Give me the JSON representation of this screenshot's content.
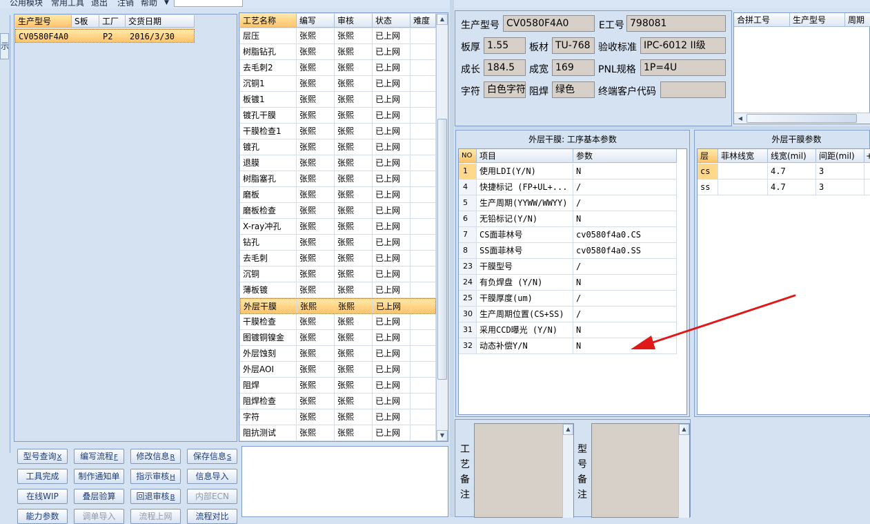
{
  "menubar": {
    "items": [
      "公用模块",
      "常用工具",
      "退出",
      "注销",
      "帮助"
    ]
  },
  "left_stub": {
    "button_label": "示"
  },
  "model_list": {
    "columns": [
      "生产型号",
      "S板",
      "工厂",
      "交货日期"
    ],
    "rows": [
      {
        "model": "CV0580F4A0",
        "s_board": "",
        "factory": "P2",
        "delivery_date": "2016/3/30"
      }
    ]
  },
  "process_list": {
    "columns": [
      "工艺名称",
      "编写",
      "审核",
      "状态",
      "难度"
    ],
    "rows": [
      [
        "层压",
        "张熙",
        "张熙",
        "已上网",
        ""
      ],
      [
        "树脂钻孔",
        "张熙",
        "张熙",
        "已上网",
        ""
      ],
      [
        "去毛刺2",
        "张熙",
        "张熙",
        "已上网",
        ""
      ],
      [
        "沉铜1",
        "张熙",
        "张熙",
        "已上网",
        ""
      ],
      [
        "板镀1",
        "张熙",
        "张熙",
        "已上网",
        ""
      ],
      [
        "镀孔干膜",
        "张熙",
        "张熙",
        "已上网",
        ""
      ],
      [
        "干膜检查1",
        "张熙",
        "张熙",
        "已上网",
        ""
      ],
      [
        "镀孔",
        "张熙",
        "张熙",
        "已上网",
        ""
      ],
      [
        "退膜",
        "张熙",
        "张熙",
        "已上网",
        ""
      ],
      [
        "树脂塞孔",
        "张熙",
        "张熙",
        "已上网",
        ""
      ],
      [
        "磨板",
        "张熙",
        "张熙",
        "已上网",
        ""
      ],
      [
        "磨板检查",
        "张熙",
        "张熙",
        "已上网",
        ""
      ],
      [
        "X-ray冲孔",
        "张熙",
        "张熙",
        "已上网",
        ""
      ],
      [
        "钻孔",
        "张熙",
        "张熙",
        "已上网",
        ""
      ],
      [
        "去毛刺",
        "张熙",
        "张熙",
        "已上网",
        ""
      ],
      [
        "沉铜",
        "张熙",
        "张熙",
        "已上网",
        ""
      ],
      [
        "薄板镀",
        "张熙",
        "张熙",
        "已上网",
        ""
      ],
      [
        "外层干膜",
        "张熙",
        "张熙",
        "已上网",
        ""
      ],
      [
        "干膜检查",
        "张熙",
        "张熙",
        "已上网",
        ""
      ],
      [
        "图镀铜镍金",
        "张熙",
        "张熙",
        "已上网",
        ""
      ],
      [
        "外层蚀刻",
        "张熙",
        "张熙",
        "已上网",
        ""
      ],
      [
        "外层AOI",
        "张熙",
        "张熙",
        "已上网",
        ""
      ],
      [
        "阻焊",
        "张熙",
        "张熙",
        "已上网",
        ""
      ],
      [
        "阻焊检查",
        "张熙",
        "张熙",
        "已上网",
        ""
      ],
      [
        "字符",
        "张熙",
        "张熙",
        "已上网",
        ""
      ],
      [
        "阻抗测试",
        "张熙",
        "张熙",
        "已上网",
        ""
      ]
    ],
    "selected_index": 17
  },
  "buttons": [
    {
      "label": "型号查询",
      "key": "X",
      "disabled": false
    },
    {
      "label": "编写流程",
      "key": "F",
      "disabled": false
    },
    {
      "label": "修改信息",
      "key": "R",
      "disabled": false
    },
    {
      "label": "保存信息",
      "key": "S",
      "disabled": false
    },
    {
      "label": "工具完成",
      "key": "",
      "disabled": false
    },
    {
      "label": "制作通知单",
      "key": "",
      "disabled": false
    },
    {
      "label": "指示审核",
      "key": "H",
      "disabled": false
    },
    {
      "label": "信息导入",
      "key": "",
      "disabled": false
    },
    {
      "label": "在线WIP",
      "key": "",
      "disabled": false
    },
    {
      "label": "叠层验算",
      "key": "",
      "disabled": false
    },
    {
      "label": "回退审核",
      "key": "B",
      "disabled": false
    },
    {
      "label": "内部ECN",
      "key": "",
      "disabled": true
    },
    {
      "label": "能力参数",
      "key": "",
      "disabled": false
    },
    {
      "label": "调单导入",
      "key": "",
      "disabled": true
    },
    {
      "label": "流程上网",
      "key": "",
      "disabled": true
    },
    {
      "label": "流程对比",
      "key": "",
      "disabled": false
    }
  ],
  "info": {
    "model_label": "生产型号",
    "model_value": "CV0580F4A0",
    "e_label": "E工号",
    "e_value": "798081",
    "thickness_label": "板厚",
    "thickness_value": "1.55",
    "material_label": "板材",
    "material_value": "TU-768",
    "standard_label": "验收标准",
    "standard_value": "IPC-6012 II级",
    "length_label": "成长",
    "length_value": "184.5",
    "width_label": "成宽",
    "width_value": "169",
    "pnl_label": "PNL规格",
    "pnl_value": "1P=4U",
    "char_label": "字符",
    "char_value": "白色字符",
    "mask_label": "阻焊",
    "mask_value": "绿色",
    "customer_label": "终端客户代码",
    "customer_value": ""
  },
  "merge_grid": {
    "columns": [
      "合拼工号",
      "生产型号",
      "周期"
    ]
  },
  "params_panel": {
    "title": "外层干膜: 工序基本参数",
    "columns": [
      "NO",
      "项目",
      "参数"
    ],
    "rows": [
      [
        "1",
        "使用LDI(Y/N)",
        "N"
      ],
      [
        "4",
        "快捷标记 (FP+UL+...",
        "/"
      ],
      [
        "5",
        "生产周期(YYWW/WWYY)",
        "/"
      ],
      [
        "6",
        "无铅标记(Y/N)",
        "N"
      ],
      [
        "7",
        "CS面菲林号",
        "cv0580f4a0.CS"
      ],
      [
        "8",
        "SS面菲林号",
        "cv0580f4a0.SS"
      ],
      [
        "23",
        "干膜型号",
        "/"
      ],
      [
        "24",
        "有负焊盘 (Y/N)",
        "N"
      ],
      [
        "25",
        "干膜厚度(um)",
        "/"
      ],
      [
        "30",
        "生产周期位置(CS+SS)",
        "/"
      ],
      [
        "31",
        "采用CCD曝光 (Y/N)",
        "N"
      ],
      [
        "32",
        "动态补偿Y/N",
        "N"
      ]
    ]
  },
  "film_panel": {
    "title": "外层干膜参数",
    "columns": [
      "层",
      "菲林线宽",
      "线宽(mil)",
      "间距(mil)",
      "+"
    ],
    "rows": [
      [
        "cs",
        "",
        "4.7",
        "3"
      ],
      [
        "ss",
        "",
        "4.7",
        "3"
      ]
    ]
  },
  "remarks": {
    "process_label": "工艺备注",
    "model_label": "型号备注"
  },
  "colors": {
    "selection": "#ffc36b",
    "arrow": "#e01818"
  }
}
